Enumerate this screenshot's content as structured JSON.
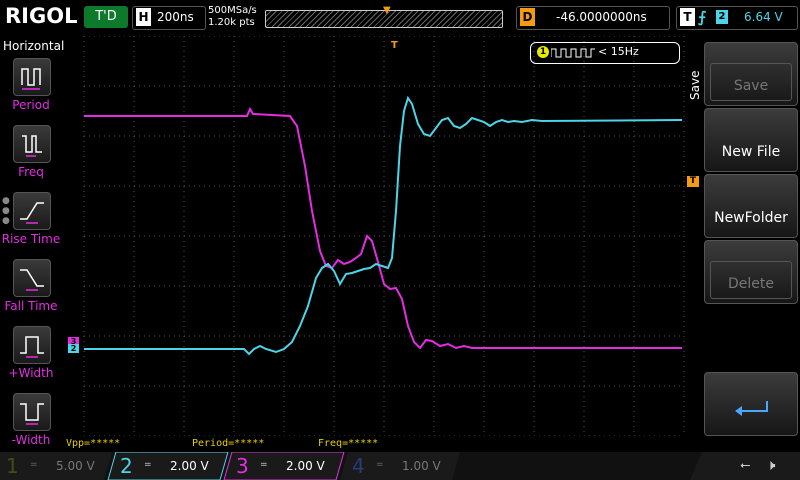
{
  "topbar": {
    "logo": "RIGOL",
    "run_state": "T'D",
    "timebase_label": "H",
    "timebase": "200ns",
    "sample_rate": "500MSa/s",
    "memory_depth": "1.20k pts",
    "delay_label": "D",
    "delay": "-46.0000000ns",
    "trigger_label": "T",
    "trigger_edge": "rising-edge-icon",
    "trigger_source": "2",
    "trigger_level": "6.64 V"
  },
  "left_menu": {
    "title": "Horizontal",
    "items": [
      {
        "label": "Period",
        "icon": "period-icon"
      },
      {
        "label": "Freq",
        "icon": "freq-icon"
      },
      {
        "label": "Rise Time",
        "icon": "rise-time-icon"
      },
      {
        "label": "Fall Time",
        "icon": "fall-time-icon"
      },
      {
        "label": "+Width",
        "icon": "pos-width-icon"
      },
      {
        "label": "-Width",
        "icon": "neg-width-icon"
      }
    ]
  },
  "screen": {
    "trigger_marker": "T",
    "trigger_level_marker": "T",
    "channel_markers": [
      "3",
      "2"
    ],
    "freq_counter": {
      "channel": "1",
      "value": "< 15Hz"
    },
    "measurements": [
      {
        "text": "Vpp=*****"
      },
      {
        "text": "Period=*****"
      },
      {
        "text": "Freq=*****"
      }
    ]
  },
  "right_menu": {
    "title": "Save",
    "buttons": [
      {
        "label": "Save",
        "enabled": false
      },
      {
        "label": "New File",
        "enabled": true
      },
      {
        "label": "NewFolder",
        "enabled": true
      },
      {
        "label": "Delete",
        "enabled": false
      }
    ],
    "back_icon": "return-arrow-icon"
  },
  "bottom_bar": {
    "channels": [
      {
        "number": "1",
        "coupling": "=",
        "scale": "5.00 V",
        "color": "#e8e800",
        "active": false
      },
      {
        "number": "2",
        "coupling": "=",
        "scale": "2.00 V",
        "color": "#4cd4e8",
        "active": true
      },
      {
        "number": "3",
        "coupling": "=",
        "scale": "2.00 V",
        "color": "#e22ee0",
        "active": true
      },
      {
        "number": "4",
        "coupling": "=",
        "scale": "1.00 V",
        "color": "#4c6cf0",
        "active": false
      }
    ],
    "usb_icon": "usb-icon",
    "mute_icon": "mute-icon"
  },
  "colors": {
    "ch1": "#e8e800",
    "ch2": "#4cd4e8",
    "ch3": "#e22ee0",
    "ch4": "#4c6cf0",
    "trigger": "#f39c12",
    "grid": "#555555"
  }
}
